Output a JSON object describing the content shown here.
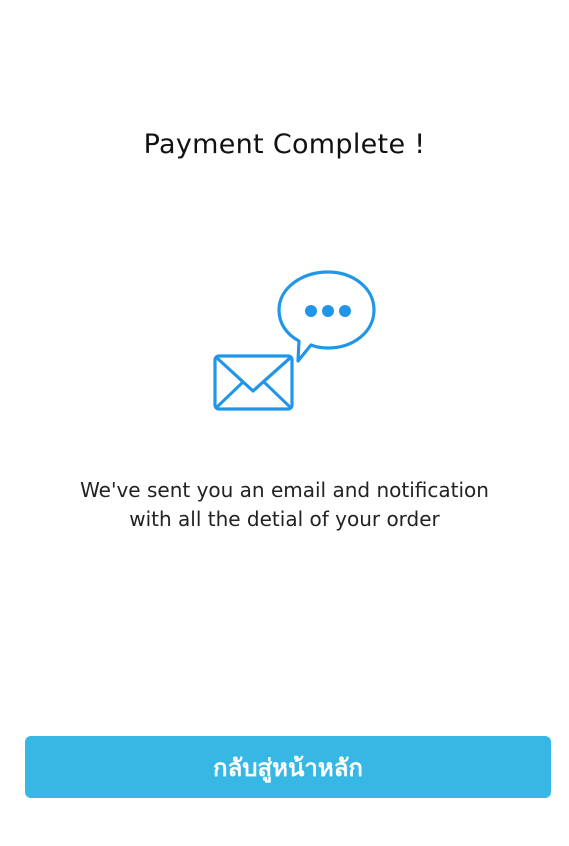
{
  "screen": {
    "title": "Payment Complete !",
    "message_line1": "We've sent you an email and notification",
    "message_line2": "with all the detial of your order",
    "primary_button_label": "กลับสู่หน้าหลัก"
  },
  "icons": {
    "illustration": "email-notification-illustration",
    "envelope": "envelope-icon",
    "speech_bubble": "chat-bubble-icon"
  },
  "colors": {
    "icon_blue": "#2196e8",
    "button_blue": "#37b7e3",
    "text": "#111111",
    "background": "#ffffff"
  }
}
